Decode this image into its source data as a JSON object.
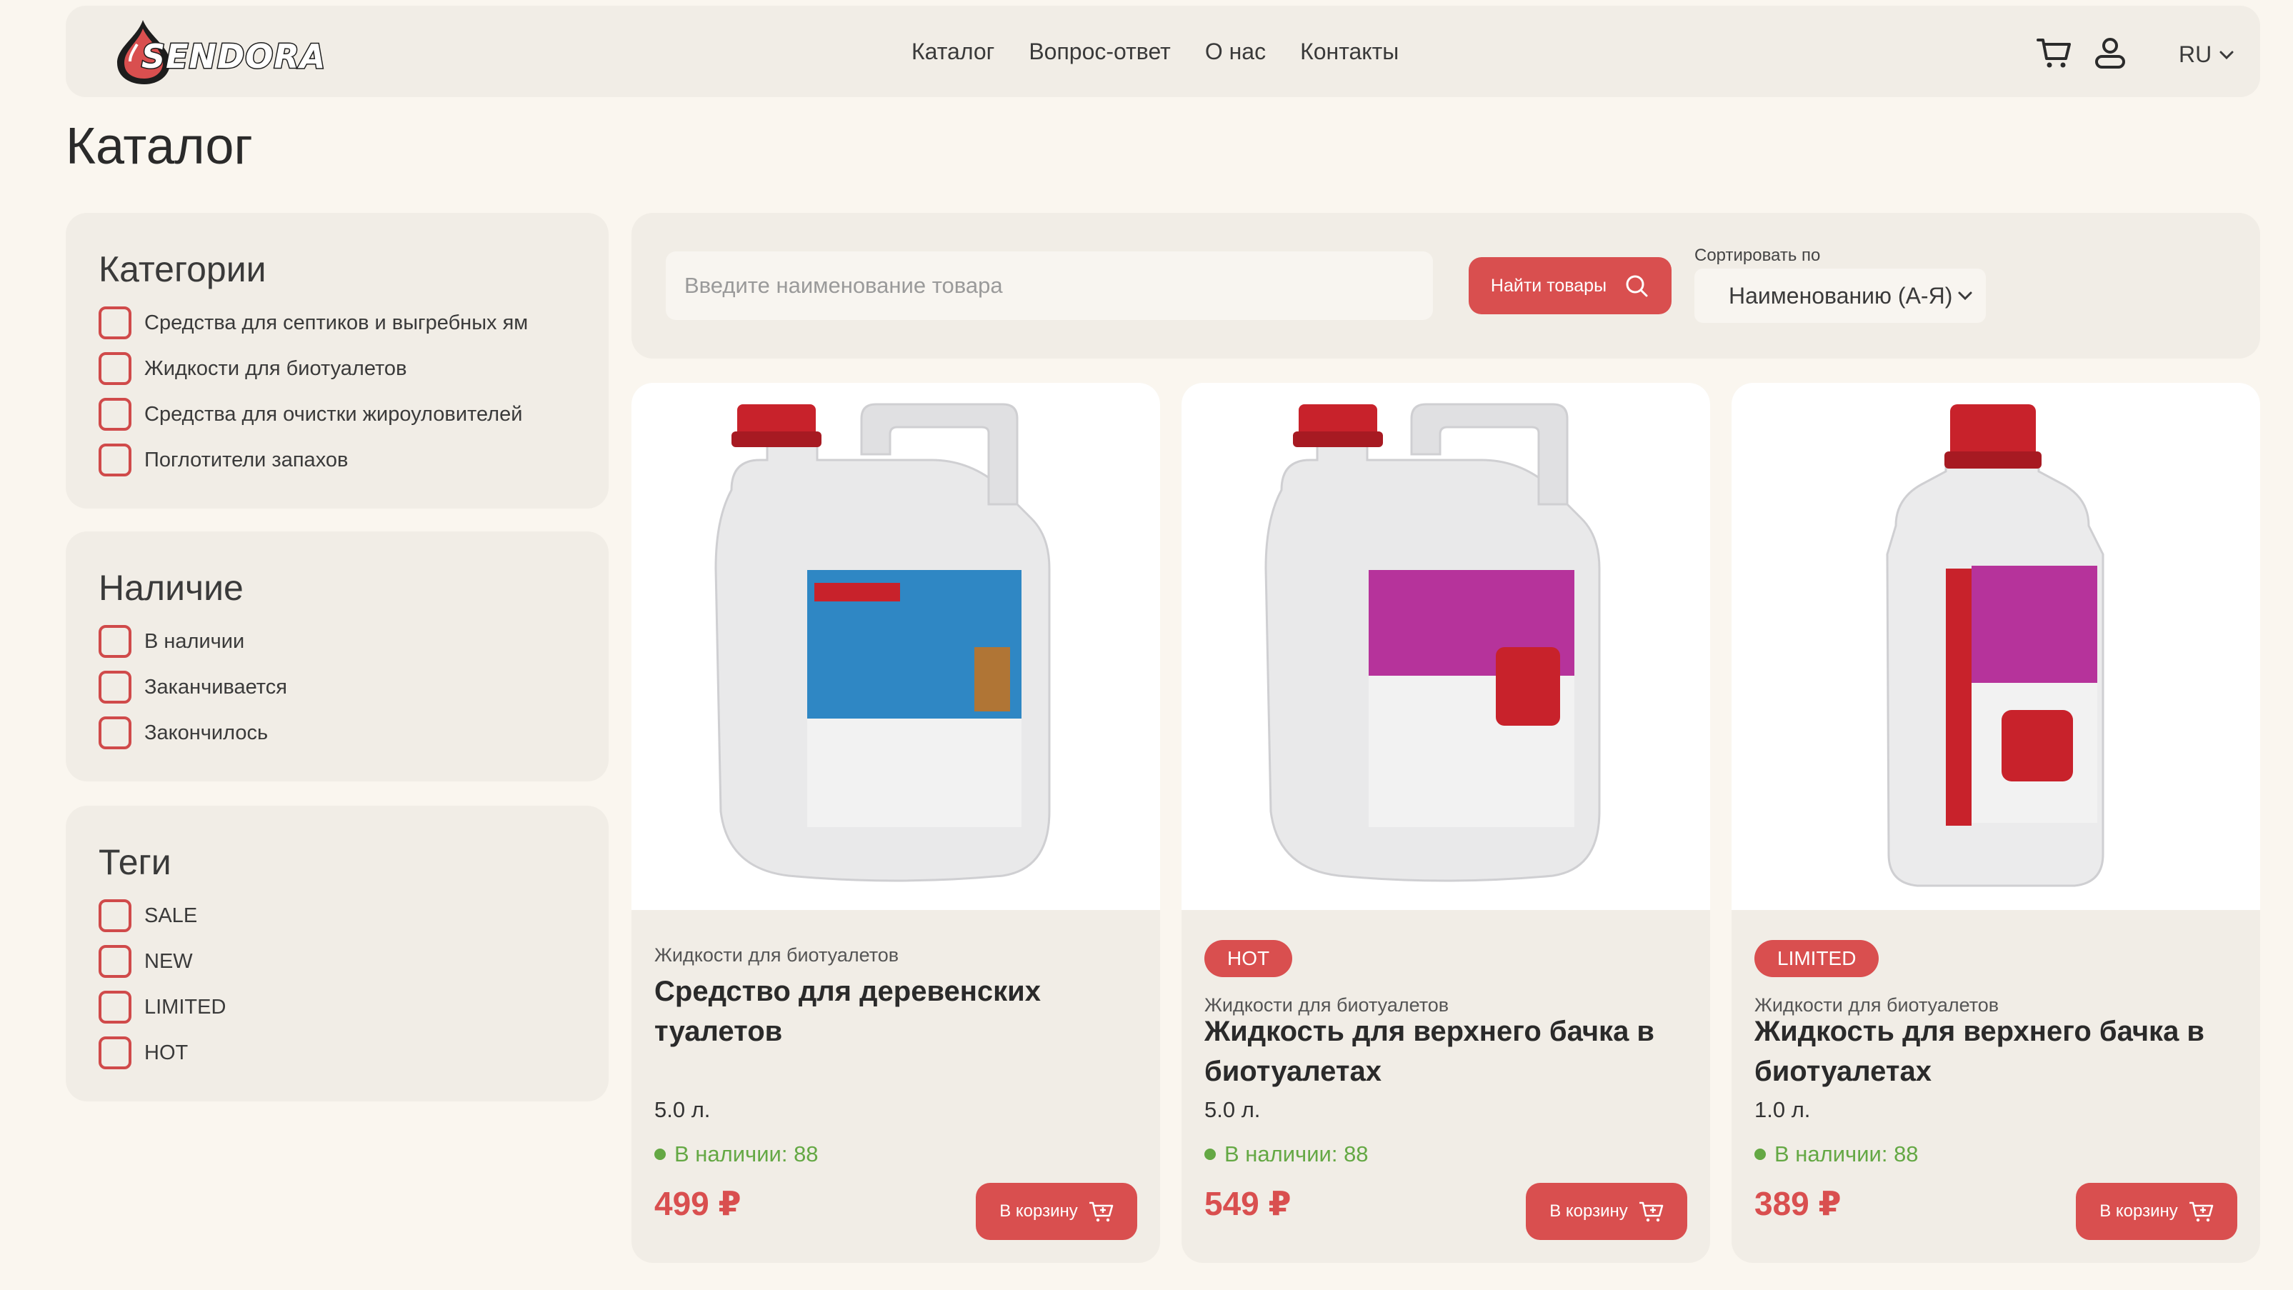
{
  "header": {
    "logo_text": "SENDORA",
    "nav": [
      "Каталог",
      "Вопрос-ответ",
      "О нас",
      "Контакты"
    ],
    "language": "RU",
    "cart_icon": "cart-icon",
    "user_icon": "user-icon"
  },
  "page_title": "Каталог",
  "filters": {
    "categories": {
      "title": "Категории",
      "items": [
        "Средства для септиков и выгребных ям",
        "Жидкости для биотуалетов",
        "Средства для очистки жироуловителей",
        "Поглотители запахов"
      ]
    },
    "availability": {
      "title": "Наличие",
      "items": [
        "В наличии",
        "Заканчивается",
        "Закончилось"
      ]
    },
    "tags": {
      "title": "Теги",
      "items": [
        "SALE",
        "NEW",
        "LIMITED",
        "HOT"
      ]
    }
  },
  "search": {
    "placeholder": "Введите наименование товара",
    "button_label": "Найти товары",
    "sort_label": "Сортировать по",
    "sort_value": "Наименованию (А-Я)"
  },
  "products": [
    {
      "badge": "",
      "category": "Жидкости для биотуалетов",
      "name": "Средство для деревенских туалетов",
      "volume": "5.0 л.",
      "stock": "В наличии: 88",
      "price": "499 ₽",
      "cart_label": "В корзину",
      "label_color": "#2f87c4"
    },
    {
      "badge": "HOT",
      "category": "Жидкости для биотуалетов",
      "name": "Жидкость для верхнего бачка в биотуалетах",
      "volume": "5.0 л.",
      "stock": "В наличии: 88",
      "price": "549 ₽",
      "cart_label": "В корзину",
      "label_color": "#b6339b"
    },
    {
      "badge": "LIMITED",
      "category": "Жидкости для биотуалетов",
      "name": "Жидкость для верхнего бачка в биотуалетах",
      "volume": "1.0 л.",
      "stock": "В наличии: 88",
      "price": "389 ₽",
      "cart_label": "В корзину",
      "label_color": "#b6339b"
    }
  ],
  "colors": {
    "accent": "#d94f4f",
    "panel": "#f1ede6",
    "background": "#faf6ef",
    "in_stock": "#64a844"
  }
}
